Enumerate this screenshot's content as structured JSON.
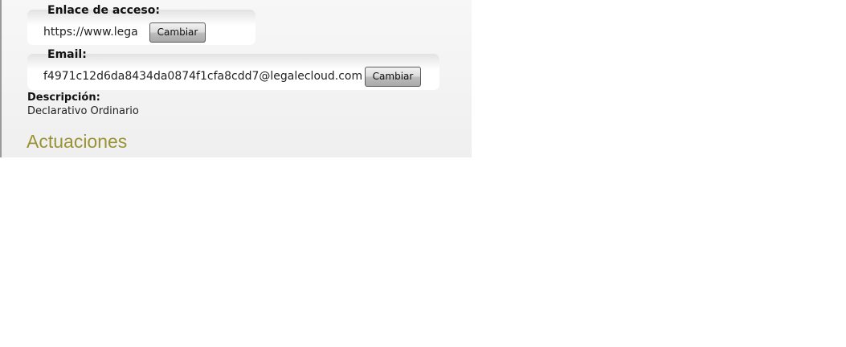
{
  "access_link": {
    "label": "Enlace de acceso:",
    "value": "https://www.lega",
    "button_label": "Cambiar"
  },
  "email": {
    "label": "Email:",
    "value": "f4971c12d6da8434da0874f1cfa8cdd7@legalecloud.com",
    "button_label": "Cambiar"
  },
  "description": {
    "label": "Descripción:",
    "value": "Declarativo Ordinario"
  },
  "actions_section": {
    "heading": "Actuaciones"
  },
  "colors": {
    "heading_olive": "#9a9336",
    "panel_border": "#9a9a9a"
  }
}
